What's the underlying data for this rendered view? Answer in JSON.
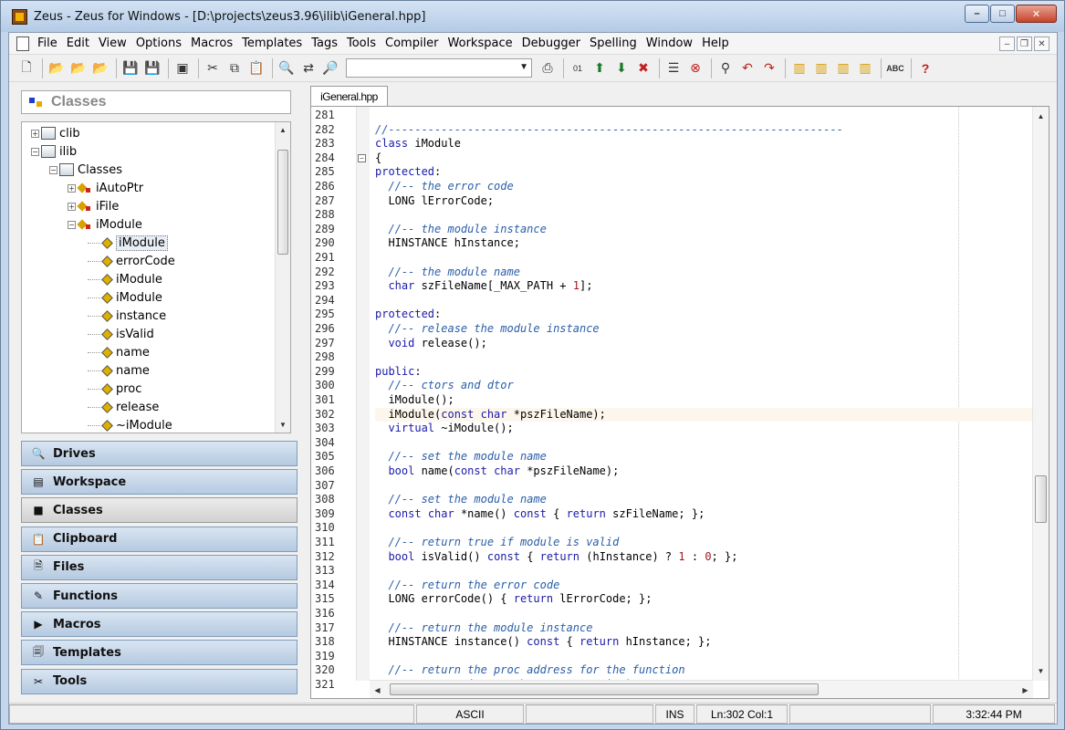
{
  "window": {
    "title": "Zeus - Zeus for Windows - [D:\\projects\\zeus3.96\\ilib\\iGeneral.hpp]",
    "minimize": "–",
    "maximize": "□",
    "close": "✕"
  },
  "menu": {
    "items": [
      "File",
      "Edit",
      "View",
      "Options",
      "Macros",
      "Templates",
      "Tags",
      "Tools",
      "Compiler",
      "Workspace",
      "Debugger",
      "Spelling",
      "Window",
      "Help"
    ],
    "mdi_min": "–",
    "mdi_restore": "❐",
    "mdi_close": "✕"
  },
  "toolbar": {
    "combo_value": "",
    "combo_arrow": "▼",
    "icons": [
      "new-file",
      "open",
      "open-2",
      "open-3",
      "save",
      "save-all",
      "print-preview",
      "cut",
      "copy",
      "paste",
      "find",
      "replace",
      "find-files",
      "print",
      "hex",
      "arrow-up",
      "arrow-down",
      "bookmark",
      "stack",
      "tool",
      "spy",
      "undo-arrow",
      "redo-arrow",
      "clip-1",
      "clip-2",
      "clip-3",
      "clip-4",
      "spell",
      "help"
    ]
  },
  "panel": {
    "header": "Classes",
    "tree": [
      {
        "label": "clib",
        "level": 0,
        "expander": "+",
        "icon": "library"
      },
      {
        "label": "ilib",
        "level": 0,
        "expander": "−",
        "icon": "library"
      },
      {
        "label": "Classes",
        "level": 1,
        "expander": "−",
        "icon": "library"
      },
      {
        "label": "iAutoPtr",
        "level": 2,
        "expander": "+",
        "icon": "class"
      },
      {
        "label": "iFile",
        "level": 2,
        "expander": "+",
        "icon": "class"
      },
      {
        "label": "iModule",
        "level": 2,
        "expander": "−",
        "icon": "class"
      },
      {
        "label": "iModule",
        "level": 3,
        "expander": "",
        "icon": "member",
        "selected": true
      },
      {
        "label": "errorCode",
        "level": 3,
        "expander": "",
        "icon": "member"
      },
      {
        "label": "iModule",
        "level": 3,
        "expander": "",
        "icon": "member"
      },
      {
        "label": "iModule",
        "level": 3,
        "expander": "",
        "icon": "member"
      },
      {
        "label": "instance",
        "level": 3,
        "expander": "",
        "icon": "member"
      },
      {
        "label": "isValid",
        "level": 3,
        "expander": "",
        "icon": "member"
      },
      {
        "label": "name",
        "level": 3,
        "expander": "",
        "icon": "member"
      },
      {
        "label": "name",
        "level": 3,
        "expander": "",
        "icon": "member"
      },
      {
        "label": "proc",
        "level": 3,
        "expander": "",
        "icon": "member"
      },
      {
        "label": "release",
        "level": 3,
        "expander": "",
        "icon": "member"
      },
      {
        "label": "~iModule",
        "level": 3,
        "expander": "",
        "icon": "member"
      }
    ],
    "buttons": [
      {
        "label": "Drives",
        "icon": "drives-icon",
        "glyph": "🔍"
      },
      {
        "label": "Workspace",
        "icon": "workspace-icon",
        "glyph": "▤"
      },
      {
        "label": "Classes",
        "icon": "classes-icon",
        "glyph": "■",
        "active": true
      },
      {
        "label": "Clipboard",
        "icon": "clipboard-icon",
        "glyph": "📋"
      },
      {
        "label": "Files",
        "icon": "files-icon",
        "glyph": "🗎"
      },
      {
        "label": "Functions",
        "icon": "functions-icon",
        "glyph": "✎"
      },
      {
        "label": "Macros",
        "icon": "macros-icon",
        "glyph": "▶"
      },
      {
        "label": "Templates",
        "icon": "templates-icon",
        "glyph": "🗐"
      },
      {
        "label": "Tools",
        "icon": "tools-icon",
        "glyph": "✂"
      }
    ]
  },
  "editor": {
    "tab": "iGeneral.hpp",
    "lines": [
      {
        "n": "281",
        "code": [
          [
            "",
            ""
          ]
        ]
      },
      {
        "n": "282",
        "code": [
          [
            "cm",
            "//---------------------------------------------------------------------"
          ]
        ]
      },
      {
        "n": "283",
        "code": [
          [
            "kw",
            "class"
          ],
          [
            "",
            " iModule"
          ]
        ]
      },
      {
        "n": "284",
        "code": [
          [
            "",
            "{"
          ]
        ],
        "fold": "−"
      },
      {
        "n": "285",
        "code": [
          [
            "kw",
            "protected"
          ],
          [
            "",
            ":"
          ]
        ]
      },
      {
        "n": "286",
        "code": [
          [
            "",
            "  "
          ],
          [
            "cm",
            "//-- the error code"
          ]
        ]
      },
      {
        "n": "287",
        "code": [
          [
            "",
            "  LONG lErrorCode;"
          ]
        ]
      },
      {
        "n": "288",
        "code": [
          [
            "",
            ""
          ]
        ]
      },
      {
        "n": "289",
        "code": [
          [
            "",
            "  "
          ],
          [
            "cm",
            "//-- the module instance"
          ]
        ]
      },
      {
        "n": "290",
        "code": [
          [
            "",
            "  HINSTANCE hInstance;"
          ]
        ]
      },
      {
        "n": "291",
        "code": [
          [
            "",
            ""
          ]
        ]
      },
      {
        "n": "292",
        "code": [
          [
            "",
            "  "
          ],
          [
            "cm",
            "//-- the module name"
          ]
        ]
      },
      {
        "n": "293",
        "code": [
          [
            "",
            "  "
          ],
          [
            "kw",
            "char"
          ],
          [
            "",
            " szFileName[_MAX_PATH + "
          ],
          [
            "nm",
            "1"
          ],
          [
            "",
            "];"
          ]
        ]
      },
      {
        "n": "294",
        "code": [
          [
            "",
            ""
          ]
        ]
      },
      {
        "n": "295",
        "code": [
          [
            "kw",
            "protected"
          ],
          [
            "",
            ":"
          ]
        ]
      },
      {
        "n": "296",
        "code": [
          [
            "",
            "  "
          ],
          [
            "cm",
            "//-- release the module instance"
          ]
        ]
      },
      {
        "n": "297",
        "code": [
          [
            "",
            "  "
          ],
          [
            "kw",
            "void"
          ],
          [
            "",
            " release();"
          ]
        ]
      },
      {
        "n": "298",
        "code": [
          [
            "",
            ""
          ]
        ]
      },
      {
        "n": "299",
        "code": [
          [
            "kw",
            "public"
          ],
          [
            "",
            ":"
          ]
        ]
      },
      {
        "n": "300",
        "code": [
          [
            "",
            "  "
          ],
          [
            "cm",
            "//-- ctors and dtor"
          ]
        ]
      },
      {
        "n": "301",
        "code": [
          [
            "",
            "  iModule();"
          ]
        ]
      },
      {
        "n": "302",
        "code": [
          [
            "",
            "  iModule("
          ],
          [
            "kw",
            "const"
          ],
          [
            "",
            " "
          ],
          [
            "kw",
            "char"
          ],
          [
            "",
            " *pszFileName);"
          ]
        ],
        "current": true
      },
      {
        "n": "303",
        "code": [
          [
            "",
            "  "
          ],
          [
            "kw",
            "virtual"
          ],
          [
            "",
            " ~iModule();"
          ]
        ]
      },
      {
        "n": "304",
        "code": [
          [
            "",
            ""
          ]
        ]
      },
      {
        "n": "305",
        "code": [
          [
            "",
            "  "
          ],
          [
            "cm",
            "//-- set the module name"
          ]
        ]
      },
      {
        "n": "306",
        "code": [
          [
            "",
            "  "
          ],
          [
            "kw",
            "bool"
          ],
          [
            "",
            " name("
          ],
          [
            "kw",
            "const"
          ],
          [
            "",
            " "
          ],
          [
            "kw",
            "char"
          ],
          [
            "",
            " *pszFileName);"
          ]
        ]
      },
      {
        "n": "307",
        "code": [
          [
            "",
            ""
          ]
        ]
      },
      {
        "n": "308",
        "code": [
          [
            "",
            "  "
          ],
          [
            "cm",
            "//-- set the module name"
          ]
        ]
      },
      {
        "n": "309",
        "code": [
          [
            "",
            "  "
          ],
          [
            "kw",
            "const"
          ],
          [
            "",
            " "
          ],
          [
            "kw",
            "char"
          ],
          [
            "",
            " *name() "
          ],
          [
            "kw",
            "const"
          ],
          [
            "",
            " { "
          ],
          [
            "kw",
            "return"
          ],
          [
            "",
            " szFileName; };"
          ]
        ]
      },
      {
        "n": "310",
        "code": [
          [
            "",
            ""
          ]
        ]
      },
      {
        "n": "311",
        "code": [
          [
            "",
            "  "
          ],
          [
            "cm",
            "//-- return true if module is valid"
          ]
        ]
      },
      {
        "n": "312",
        "code": [
          [
            "",
            "  "
          ],
          [
            "kw",
            "bool"
          ],
          [
            "",
            " isValid() "
          ],
          [
            "kw",
            "const"
          ],
          [
            "",
            " { "
          ],
          [
            "kw",
            "return"
          ],
          [
            "",
            " (hInstance) ? "
          ],
          [
            "nm",
            "1"
          ],
          [
            "",
            " : "
          ],
          [
            "nm",
            "0"
          ],
          [
            "",
            "; };"
          ]
        ]
      },
      {
        "n": "313",
        "code": [
          [
            "",
            ""
          ]
        ]
      },
      {
        "n": "314",
        "code": [
          [
            "",
            "  "
          ],
          [
            "cm",
            "//-- return the error code"
          ]
        ]
      },
      {
        "n": "315",
        "code": [
          [
            "",
            "  LONG errorCode() { "
          ],
          [
            "kw",
            "return"
          ],
          [
            "",
            " lErrorCode; };"
          ]
        ]
      },
      {
        "n": "316",
        "code": [
          [
            "",
            ""
          ]
        ]
      },
      {
        "n": "317",
        "code": [
          [
            "",
            "  "
          ],
          [
            "cm",
            "//-- return the module instance"
          ]
        ]
      },
      {
        "n": "318",
        "code": [
          [
            "",
            "  HINSTANCE instance() "
          ],
          [
            "kw",
            "const"
          ],
          [
            "",
            " { "
          ],
          [
            "kw",
            "return"
          ],
          [
            "",
            " hInstance; };"
          ]
        ]
      },
      {
        "n": "319",
        "code": [
          [
            "",
            ""
          ]
        ]
      },
      {
        "n": "320",
        "code": [
          [
            "",
            "  "
          ],
          [
            "cm",
            "//-- return the proc address for the function"
          ]
        ]
      },
      {
        "n": "321",
        "code": [
          [
            "",
            "  FARPROC proc("
          ],
          [
            "kw",
            "const"
          ],
          [
            "",
            " "
          ],
          [
            "kw",
            "char"
          ],
          [
            "",
            " *pszFunction);"
          ]
        ]
      }
    ]
  },
  "status": {
    "blank1": "",
    "encoding": "ASCII",
    "blank2": "",
    "mode": "INS",
    "position": "Ln:302 Col:1",
    "blank3": "",
    "time": "3:32:44 PM"
  }
}
